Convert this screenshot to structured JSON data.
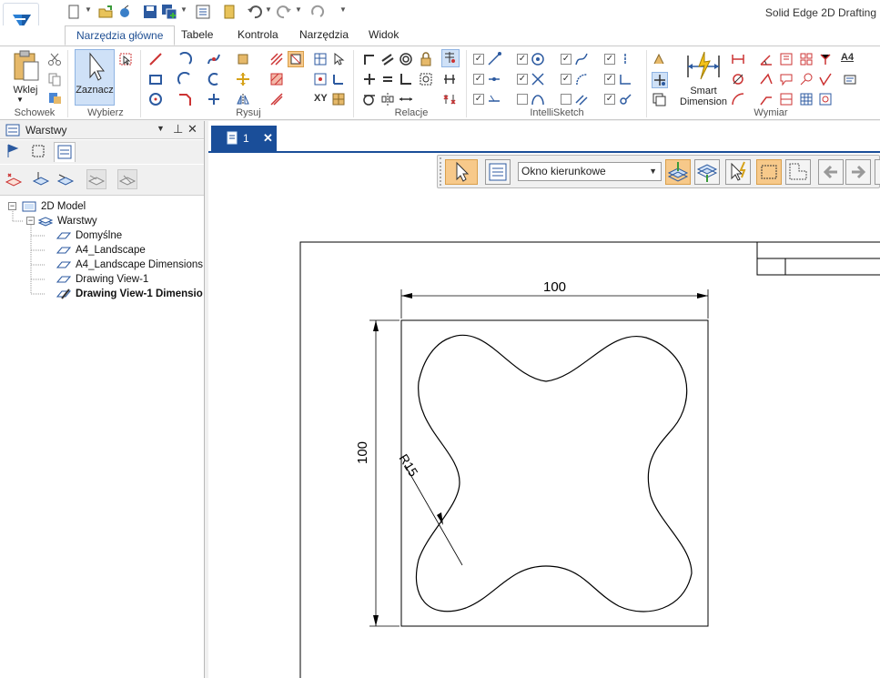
{
  "app": {
    "title": "Solid Edge 2D Drafting"
  },
  "tabs": [
    {
      "label": "Narzędzia główne",
      "active": true
    },
    {
      "label": "Tabele"
    },
    {
      "label": "Kontrola"
    },
    {
      "label": "Narzędzia"
    },
    {
      "label": "Widok"
    }
  ],
  "ribbon": {
    "groups": {
      "clipboard": "Schowek",
      "select": "Wybierz",
      "draw": "Rysuj",
      "relations": "Relacje",
      "intellisketch": "IntelliSketch",
      "dimension": "Wymiar"
    },
    "paste_label": "Wklej",
    "select_tool_label": "Zaznacz",
    "smart_dimension_label_1": "Smart",
    "smart_dimension_label_2": "Dimension",
    "xy_label": "XY",
    "a4_label": "A4"
  },
  "panel": {
    "title": "Warstwy",
    "tree": [
      {
        "label": "2D Model",
        "level": 0
      },
      {
        "label": "Warstwy",
        "level": 1
      },
      {
        "label": "Domyślne",
        "level": 2
      },
      {
        "label": "A4_Landscape",
        "level": 2
      },
      {
        "label": "A4_Landscape Dimensions",
        "level": 2
      },
      {
        "label": "Drawing View-1",
        "level": 2
      },
      {
        "label": "Drawing View-1 Dimensions",
        "level": 2,
        "bold": true
      }
    ]
  },
  "document": {
    "tab_label": "1",
    "close_glyph": "✕"
  },
  "commandbar": {
    "selection_mode": "Okno kierunkowe"
  },
  "drawing": {
    "dim_width": "100",
    "dim_height": "100",
    "dim_radius": "R15"
  },
  "colors": {
    "accent": "#1a4e99",
    "active_tool": "#f7c98a"
  }
}
